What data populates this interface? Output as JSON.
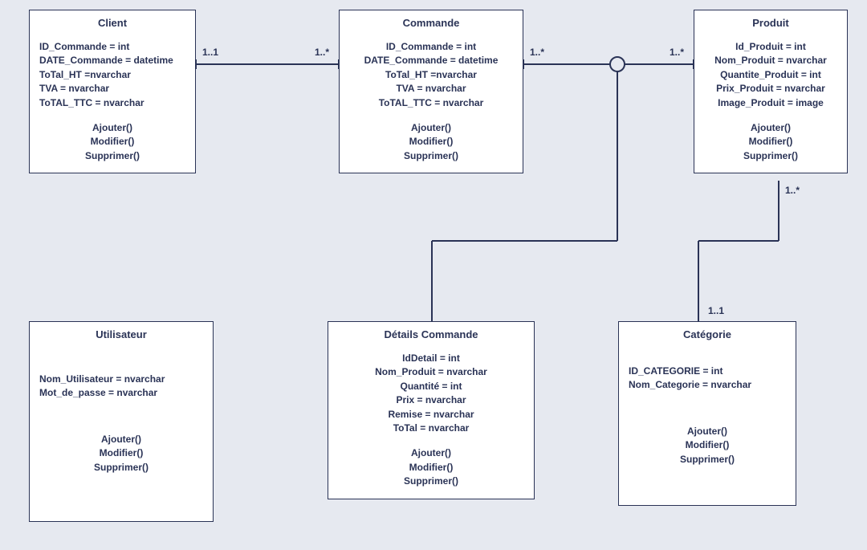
{
  "entities": {
    "client": {
      "name": "Client",
      "attrs": [
        "ID_Commande = int",
        "DATE_Commande = datetime",
        "ToTal_HT =nvarchar",
        "TVA = nvarchar",
        "ToTAL_TTC = nvarchar"
      ],
      "methods": [
        "Ajouter()",
        "Modifier()",
        "Supprimer()"
      ]
    },
    "commande": {
      "name": "Commande",
      "attrs": [
        "ID_Commande = int",
        "DATE_Commande = datetime",
        "ToTal_HT =nvarchar",
        "TVA = nvarchar",
        "ToTAL_TTC = nvarchar"
      ],
      "methods": [
        "Ajouter()",
        "Modifier()",
        "Supprimer()"
      ]
    },
    "produit": {
      "name": "Produit",
      "attrs": [
        "Id_Produit = int",
        "Nom_Produit = nvarchar",
        "Quantite_Produit = int",
        "Prix_Produit = nvarchar",
        "Image_Produit = image"
      ],
      "methods": [
        "Ajouter()",
        "Modifier()",
        "Supprimer()"
      ]
    },
    "utilisateur": {
      "name": "Utilisateur",
      "attrs": [
        "Nom_Utilisateur = nvarchar",
        "Mot_de_passe = nvarchar"
      ],
      "methods": [
        "Ajouter()",
        "Modifier()",
        "Supprimer()"
      ]
    },
    "details": {
      "name": "Détails Commande",
      "attrs": [
        "IdDetail = int",
        "Nom_Produit = nvarchar",
        "Quantité = int",
        "Prix = nvarchar",
        "Remise = nvarchar",
        "ToTal = nvarchar"
      ],
      "methods": [
        "Ajouter()",
        "Modifier()",
        "Supprimer()"
      ]
    },
    "categorie": {
      "name": "Catégorie",
      "attrs": [
        "ID_CATEGORIE = int",
        "Nom_Categorie = nvarchar"
      ],
      "methods": [
        "Ajouter()",
        "Modifier()",
        "Supprimer()"
      ]
    }
  },
  "multiplicities": {
    "client_commande_left": "1..1",
    "client_commande_right": "1..*",
    "commande_produit_left": "1..*",
    "commande_produit_right": "1..*",
    "produit_categorie_top": "1..*",
    "produit_categorie_bottom": "1..1"
  },
  "chart_data": {
    "type": "table",
    "description": "UML-style class diagram",
    "entities": [
      {
        "name": "Client",
        "attributes": [
          "ID_Commande:int",
          "DATE_Commande:datetime",
          "ToTal_HT:nvarchar",
          "TVA:nvarchar",
          "ToTAL_TTC:nvarchar"
        ],
        "methods": [
          "Ajouter",
          "Modifier",
          "Supprimer"
        ]
      },
      {
        "name": "Commande",
        "attributes": [
          "ID_Commande:int",
          "DATE_Commande:datetime",
          "ToTal_HT:nvarchar",
          "TVA:nvarchar",
          "ToTAL_TTC:nvarchar"
        ],
        "methods": [
          "Ajouter",
          "Modifier",
          "Supprimer"
        ]
      },
      {
        "name": "Produit",
        "attributes": [
          "Id_Produit:int",
          "Nom_Produit:nvarchar",
          "Quantite_Produit:int",
          "Prix_Produit:nvarchar",
          "Image_Produit:image"
        ],
        "methods": [
          "Ajouter",
          "Modifier",
          "Supprimer"
        ]
      },
      {
        "name": "Utilisateur",
        "attributes": [
          "Nom_Utilisateur:nvarchar",
          "Mot_de_passe:nvarchar"
        ],
        "methods": [
          "Ajouter",
          "Modifier",
          "Supprimer"
        ]
      },
      {
        "name": "Détails Commande",
        "attributes": [
          "IdDetail:int",
          "Nom_Produit:nvarchar",
          "Quantité:int",
          "Prix:nvarchar",
          "Remise:nvarchar",
          "ToTal:nvarchar"
        ],
        "methods": [
          "Ajouter",
          "Modifier",
          "Supprimer"
        ]
      },
      {
        "name": "Catégorie",
        "attributes": [
          "ID_CATEGORIE:int",
          "Nom_Categorie:nvarchar"
        ],
        "methods": [
          "Ajouter",
          "Modifier",
          "Supprimer"
        ]
      }
    ],
    "relationships": [
      {
        "from": "Client",
        "to": "Commande",
        "from_mult": "1..1",
        "to_mult": "1..*"
      },
      {
        "from": "Commande",
        "to": "Produit",
        "from_mult": "1..*",
        "to_mult": "1..*",
        "association_class": "Détails Commande"
      },
      {
        "from": "Produit",
        "to": "Catégorie",
        "from_mult": "1..*",
        "to_mult": "1..1"
      }
    ]
  }
}
